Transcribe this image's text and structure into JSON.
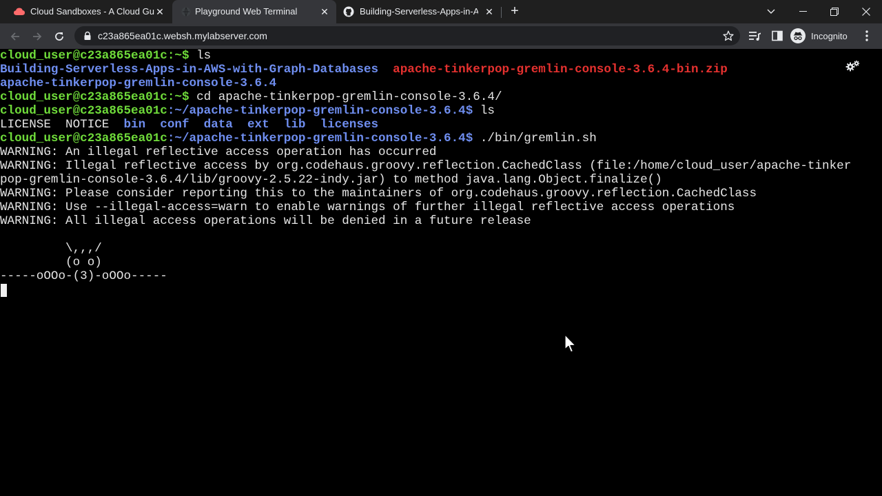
{
  "browser": {
    "tabs": [
      {
        "title": "Cloud Sandboxes - A Cloud Guru",
        "favicon": "acg-icon",
        "active": false
      },
      {
        "title": "Playground Web Terminal",
        "favicon": "globe-icon",
        "active": true
      },
      {
        "title": "Building-Serverless-Apps-in-AWS",
        "favicon": "github-icon",
        "active": false
      }
    ],
    "url": "c23a865ea01c.websh.mylabserver.com",
    "profile_label": "Incognito"
  },
  "terminal": {
    "prompt_user": "cloud_user@c23a865ea01c",
    "lines": {
      "l1_path": ":~$ ",
      "l1_cmd": "ls",
      "l2_dir": "Building-Serverless-Apps-in-AWS-with-Graph-Databases",
      "l2_zip": "apache-tinkerpop-gremlin-console-3.6.4-bin.zip",
      "l3_dir": "apache-tinkerpop-gremlin-console-3.6.4",
      "l4_path": ":~$ ",
      "l4_cmd": "cd apache-tinkerpop-gremlin-console-3.6.4/",
      "l5_path": ":~/apache-tinkerpop-gremlin-console-3.6.4$ ",
      "l5_cmd": "ls",
      "l6_files": "LICENSE  NOTICE  ",
      "l6_dirs": "bin  conf  data  ext  lib  licenses",
      "l7_path": ":~/apache-tinkerpop-gremlin-console-3.6.4$ ",
      "l7_cmd": "./bin/gremlin.sh",
      "w1": "WARNING: An illegal reflective access operation has occurred",
      "w2a": "WARNING: Illegal reflective access by org.codehaus.groovy.reflection.CachedClass (file:/home/cloud_user/apache-tinker",
      "w2b": "pop-gremlin-console-3.6.4/lib/groovy-2.5.22-indy.jar) to method java.lang.Object.finalize()",
      "w3": "WARNING: Please consider reporting this to the maintainers of org.codehaus.groovy.reflection.CachedClass",
      "w4": "WARNING: Use --illegal-access=warn to enable warnings of further illegal reflective access operations",
      "w5": "WARNING: All illegal access operations will be denied in a future release",
      "art1": "         \\,,,/",
      "art2": "         (o o)",
      "art3": "-----oOOo-(3)-oOOo-----"
    }
  },
  "colors": {
    "prompt_green": "#6fdb3a",
    "dir_blue": "#6f8ef0",
    "archive_red": "#e5312f"
  }
}
